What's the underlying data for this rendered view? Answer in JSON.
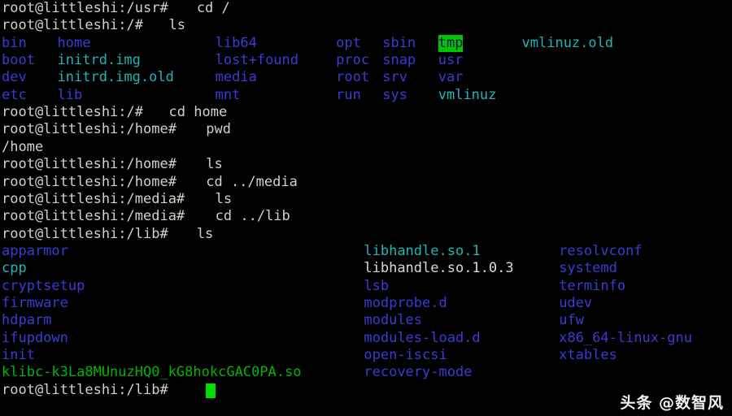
{
  "terminal": {
    "title": "root@littleshi terminal",
    "background": "#000000",
    "colors": {
      "prompt": "#d4d0c8",
      "directory": "#3b3bd4",
      "symlink": "#1fb6b6",
      "executable": "#00b400",
      "regular_file": "#d9d9d9",
      "sticky_dir_fg": "#14145a",
      "sticky_dir_bg": "#00c400",
      "cursor": "#00e000"
    },
    "lines": [
      {
        "prompt": "root@littleshi:/usr# ",
        "command": "cd /"
      },
      {
        "prompt": "root@littleshi:/# ",
        "command": "ls"
      },
      {
        "prompt": "root@littleshi:/# ",
        "command": "cd home"
      },
      {
        "prompt": "root@littleshi:/home# ",
        "command": "pwd"
      },
      {
        "prompt": "",
        "command": "/home"
      },
      {
        "prompt": "root@littleshi:/home# ",
        "command": "ls"
      },
      {
        "prompt": "root@littleshi:/home# ",
        "command": "cd ../media"
      },
      {
        "prompt": "root@littleshi:/media# ",
        "command": "ls"
      },
      {
        "prompt": "root@littleshi:/media# ",
        "command": "cd ../lib"
      },
      {
        "prompt": "root@littleshi:/lib# ",
        "command": "ls"
      },
      {
        "prompt": "root@littleshi:/lib# ",
        "command": ""
      }
    ],
    "root_listing": [
      {
        "name": "bin",
        "type": "directory",
        "col": 0,
        "row": 0
      },
      {
        "name": "home",
        "type": "directory",
        "col": 6,
        "row": 0
      },
      {
        "name": "lib64",
        "type": "directory",
        "col": 23,
        "row": 0
      },
      {
        "name": "opt",
        "type": "directory",
        "col": 36,
        "row": 0
      },
      {
        "name": "sbin",
        "type": "directory",
        "col": 41,
        "row": 0
      },
      {
        "name": "tmp",
        "type": "sticky-directory",
        "col": 47,
        "row": 0
      },
      {
        "name": "vmlinuz.old",
        "type": "symlink",
        "col": 56,
        "row": 0
      },
      {
        "name": "boot",
        "type": "directory",
        "col": 0,
        "row": 1
      },
      {
        "name": "initrd.img",
        "type": "symlink",
        "col": 6,
        "row": 1
      },
      {
        "name": "lost+found",
        "type": "directory",
        "col": 23,
        "row": 1
      },
      {
        "name": "proc",
        "type": "directory",
        "col": 36,
        "row": 1
      },
      {
        "name": "snap",
        "type": "directory",
        "col": 41,
        "row": 1
      },
      {
        "name": "usr",
        "type": "directory",
        "col": 47,
        "row": 1
      },
      {
        "name": "dev",
        "type": "directory",
        "col": 0,
        "row": 2
      },
      {
        "name": "initrd.img.old",
        "type": "symlink",
        "col": 6,
        "row": 2
      },
      {
        "name": "media",
        "type": "directory",
        "col": 23,
        "row": 2
      },
      {
        "name": "root",
        "type": "directory",
        "col": 36,
        "row": 2
      },
      {
        "name": "srv",
        "type": "directory",
        "col": 41,
        "row": 2
      },
      {
        "name": "var",
        "type": "directory",
        "col": 47,
        "row": 2
      },
      {
        "name": "etc",
        "type": "directory",
        "col": 0,
        "row": 3
      },
      {
        "name": "lib",
        "type": "directory",
        "col": 6,
        "row": 3
      },
      {
        "name": "mnt",
        "type": "directory",
        "col": 23,
        "row": 3
      },
      {
        "name": "run",
        "type": "directory",
        "col": 36,
        "row": 3
      },
      {
        "name": "sys",
        "type": "directory",
        "col": 41,
        "row": 3
      },
      {
        "name": "vmlinuz",
        "type": "symlink",
        "col": 47,
        "row": 3
      }
    ],
    "lib_listing": [
      {
        "name": "apparmor",
        "type": "directory",
        "col": 0,
        "row": 0
      },
      {
        "name": "libhandle.so.1",
        "type": "symlink",
        "col": 39,
        "row": 0
      },
      {
        "name": "resolvconf",
        "type": "directory",
        "col": 60,
        "row": 0
      },
      {
        "name": "cpp",
        "type": "symlink",
        "col": 0,
        "row": 1
      },
      {
        "name": "libhandle.so.1.0.3",
        "type": "regular",
        "col": 39,
        "row": 1
      },
      {
        "name": "systemd",
        "type": "directory",
        "col": 60,
        "row": 1
      },
      {
        "name": "cryptsetup",
        "type": "directory",
        "col": 0,
        "row": 2
      },
      {
        "name": "lsb",
        "type": "directory",
        "col": 39,
        "row": 2
      },
      {
        "name": "terminfo",
        "type": "directory",
        "col": 60,
        "row": 2
      },
      {
        "name": "firmware",
        "type": "directory",
        "col": 0,
        "row": 3
      },
      {
        "name": "modprobe.d",
        "type": "directory",
        "col": 39,
        "row": 3
      },
      {
        "name": "udev",
        "type": "directory",
        "col": 60,
        "row": 3
      },
      {
        "name": "hdparm",
        "type": "directory",
        "col": 0,
        "row": 4
      },
      {
        "name": "modules",
        "type": "directory",
        "col": 39,
        "row": 4
      },
      {
        "name": "ufw",
        "type": "directory",
        "col": 60,
        "row": 4
      },
      {
        "name": "ifupdown",
        "type": "directory",
        "col": 0,
        "row": 5
      },
      {
        "name": "modules-load.d",
        "type": "directory",
        "col": 39,
        "row": 5
      },
      {
        "name": "x86_64-linux-gnu",
        "type": "directory",
        "col": 60,
        "row": 5
      },
      {
        "name": "init",
        "type": "directory",
        "col": 0,
        "row": 6
      },
      {
        "name": "open-iscsi",
        "type": "directory",
        "col": 39,
        "row": 6
      },
      {
        "name": "xtables",
        "type": "directory",
        "col": 60,
        "row": 6
      },
      {
        "name": "klibc-k3La8MUnuzHQ0_kG8hokcGAC0PA.so",
        "type": "executable",
        "col": 0,
        "row": 7
      },
      {
        "name": "recovery-mode",
        "type": "directory",
        "col": 39,
        "row": 7
      }
    ]
  },
  "watermark": {
    "text": "头条 @数智风"
  }
}
